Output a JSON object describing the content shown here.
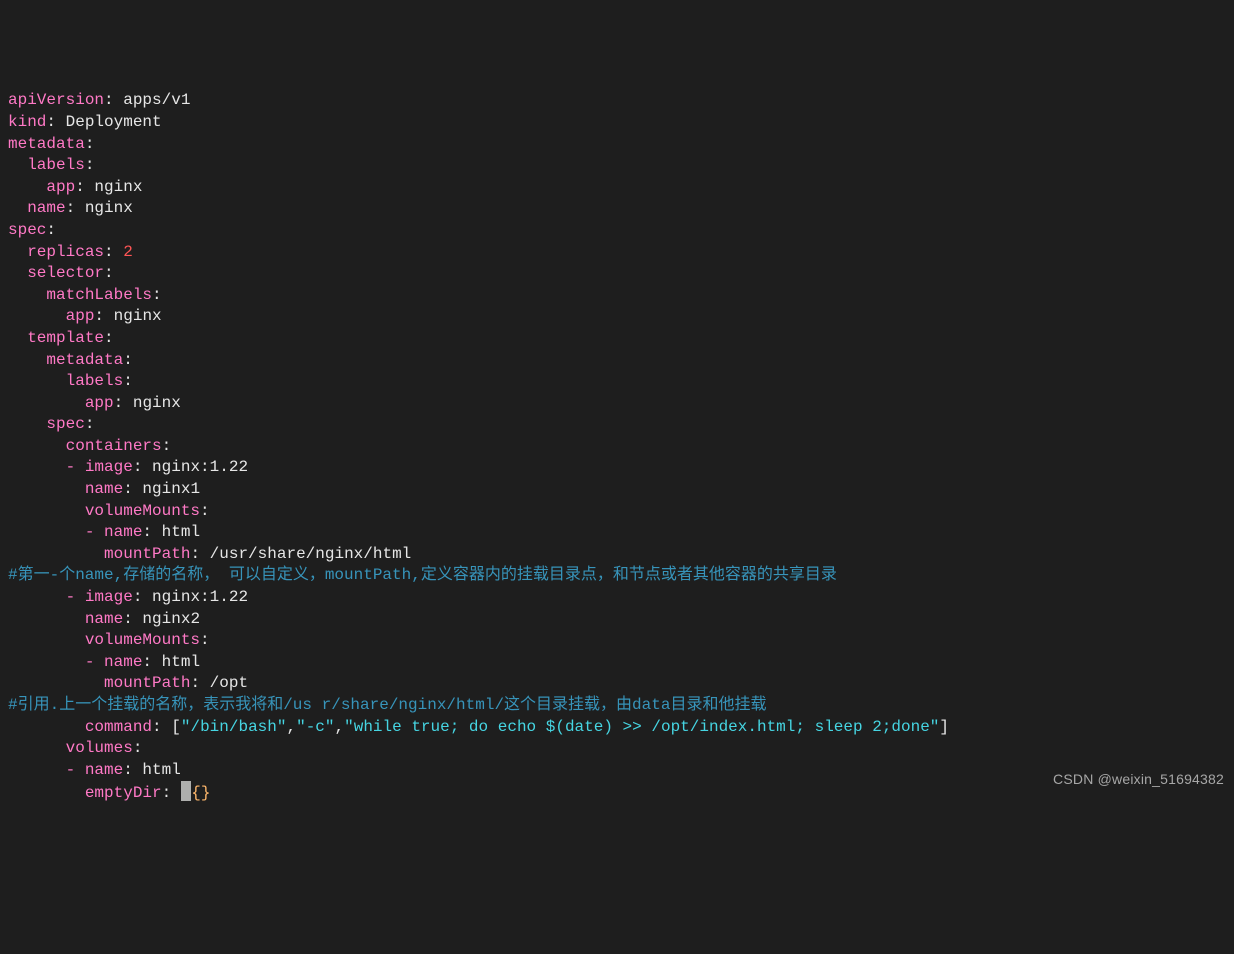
{
  "lines": {
    "l1_key": "apiVersion",
    "l1_colon": ":",
    "l1_val": " apps/v1",
    "l2_key": "kind",
    "l2_colon": ":",
    "l2_val": " Deployment",
    "l3_key": "metadata",
    "l3_colon": ":",
    "l4_ind": "  ",
    "l4_key": "labels",
    "l4_colon": ":",
    "l5_ind": "    ",
    "l5_key": "app",
    "l5_colon": ":",
    "l5_val": " nginx",
    "l6_ind": "  ",
    "l6_key": "name",
    "l6_colon": ":",
    "l6_val": " nginx",
    "l7_key": "spec",
    "l7_colon": ":",
    "l8_ind": "  ",
    "l8_key": "replicas",
    "l8_colon": ":",
    "l8_val": " 2",
    "l9_ind": "  ",
    "l9_key": "selector",
    "l9_colon": ":",
    "l10_ind": "    ",
    "l10_key": "matchLabels",
    "l10_colon": ":",
    "l11_ind": "      ",
    "l11_key": "app",
    "l11_colon": ":",
    "l11_val": " nginx",
    "l12_ind": "  ",
    "l12_key": "template",
    "l12_colon": ":",
    "l13_ind": "    ",
    "l13_key": "metadata",
    "l13_colon": ":",
    "l14_ind": "      ",
    "l14_key": "labels",
    "l14_colon": ":",
    "l15_ind": "        ",
    "l15_key": "app",
    "l15_colon": ":",
    "l15_val": " nginx",
    "l16_ind": "    ",
    "l16_key": "spec",
    "l16_colon": ":",
    "l17_ind": "      ",
    "l17_key": "containers",
    "l17_colon": ":",
    "l18_ind": "      ",
    "l18_dash": "- ",
    "l18_key": "image",
    "l18_colon": ":",
    "l18_val": " nginx:1.22",
    "l19_ind": "        ",
    "l19_key": "name",
    "l19_colon": ":",
    "l19_val": " nginx1",
    "l20_ind": "        ",
    "l20_key": "volumeMounts",
    "l20_colon": ":",
    "l21_ind": "        ",
    "l21_dash": "- ",
    "l21_key": "name",
    "l21_colon": ":",
    "l21_val": " html",
    "l22_ind": "          ",
    "l22_key": "mountPath",
    "l22_colon": ":",
    "l22_val": " /usr/share/nginx/html",
    "l23_cmt": "#第一-个name,存储的名称， 可以自定义，mountPath,定义容器内的挂载目录点，和节点或者其他容器的共享目录",
    "l24_ind": "      ",
    "l24_dash": "- ",
    "l24_key": "image",
    "l24_colon": ":",
    "l24_val": " nginx:1.22",
    "l25_ind": "        ",
    "l25_key": "name",
    "l25_colon": ":",
    "l25_val": " nginx2",
    "l26_ind": "        ",
    "l26_key": "volumeMounts",
    "l26_colon": ":",
    "l27_ind": "        ",
    "l27_dash": "- ",
    "l27_key": "name",
    "l27_colon": ":",
    "l27_val": " html",
    "l28_ind": "          ",
    "l28_key": "mountPath",
    "l28_colon": ":",
    "l28_val": " /opt",
    "l29_cmt": "#引用.上一个挂载的名称，表示我将和/us r/share/nginx/html/这个目录挂载，由data目录和他挂载",
    "l30_ind": "        ",
    "l30_key": "command",
    "l30_colon": ":",
    "l30_sp": " ",
    "l30_lb": "[",
    "l30_s1": "\"/bin/bash\"",
    "l30_c1": ",",
    "l30_s2": "\"-c\"",
    "l30_c2": ",",
    "l30_s3": "\"while true; do echo $(date) >> /opt/index.html; sleep 2;done\"",
    "l30_rb": "]",
    "l31_ind": "      ",
    "l31_key": "volumes",
    "l31_colon": ":",
    "l32_ind": "      ",
    "l32_dash": "- ",
    "l32_key": "name",
    "l32_colon": ":",
    "l32_val": " html",
    "l33_ind": "        ",
    "l33_key": "emptyDir",
    "l33_colon": ":",
    "l33_sp": " ",
    "l33_brace": "{}"
  },
  "watermark": "CSDN @weixin_51694382"
}
